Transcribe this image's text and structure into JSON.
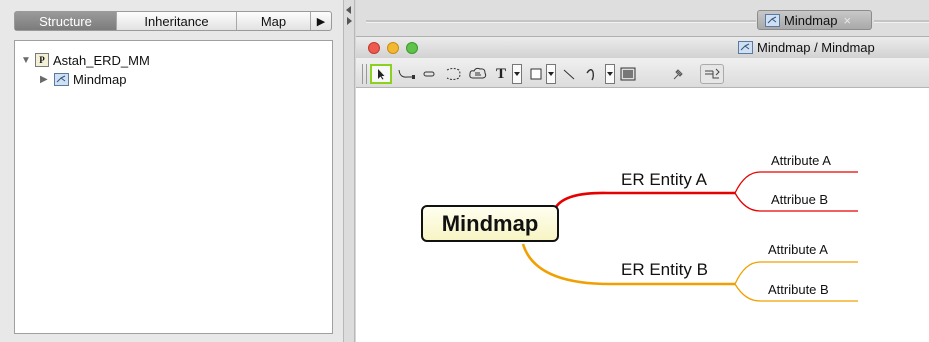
{
  "left_tabs": [
    "Structure",
    "Inheritance",
    "Map"
  ],
  "left_tab_more": "▶",
  "tree": {
    "root_label": "Astah_ERD_MM",
    "root_icon_letter": "P",
    "child_label": "Mindmap"
  },
  "editor": {
    "doc_tab_label": "Mindmap",
    "doc_tab_close": "×",
    "window_title": "Mindmap / Mindmap"
  },
  "toolbar": {
    "text_tool": "T"
  },
  "mindmap": {
    "central": "Mindmap",
    "topics": [
      {
        "label": "ER Entity A",
        "color": "#e60000",
        "attributes": [
          "Attribute A",
          "Attribue B"
        ]
      },
      {
        "label": "ER Entity B",
        "color": "#f0a000",
        "attributes": [
          "Attribute A",
          "Attribute B"
        ]
      }
    ]
  }
}
